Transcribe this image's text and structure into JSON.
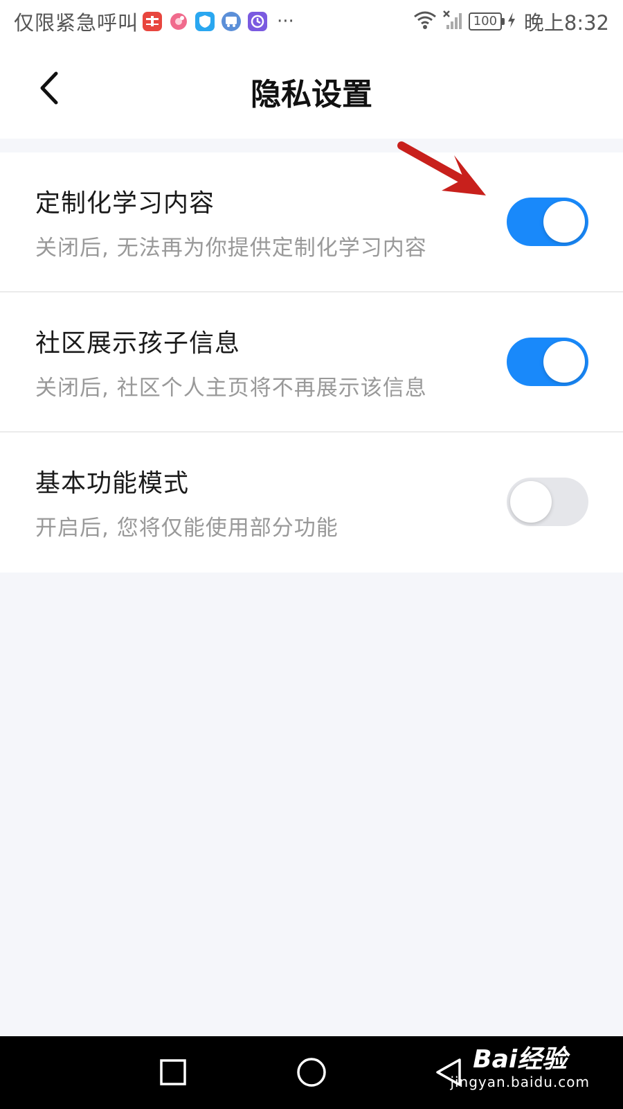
{
  "status_bar": {
    "carrier_text": "仅限紧急呼叫",
    "battery_level": "100",
    "time": "晚上8:32",
    "notification_icons": [
      "qijia-app-icon",
      "flower-app-icon",
      "shield-app-icon",
      "bus-app-icon",
      "clock-app-icon"
    ],
    "more_label": "···"
  },
  "header": {
    "title": "隐私设置"
  },
  "settings": [
    {
      "title": "定制化学习内容",
      "description": "关闭后, 无法再为你提供定制化学习内容",
      "enabled": true
    },
    {
      "title": "社区展示孩子信息",
      "description": "关闭后, 社区个人主页将不再展示该信息",
      "enabled": true
    },
    {
      "title": "基本功能模式",
      "description": "开启后, 您将仅能使用部分功能",
      "enabled": false
    }
  ],
  "watermark": {
    "main": "Bai经验",
    "sub": "jingyan.baidu.com"
  },
  "colors": {
    "toggle_on": "#1989fa",
    "toggle_off": "#e5e6ea",
    "arrow": "#c8201c"
  }
}
